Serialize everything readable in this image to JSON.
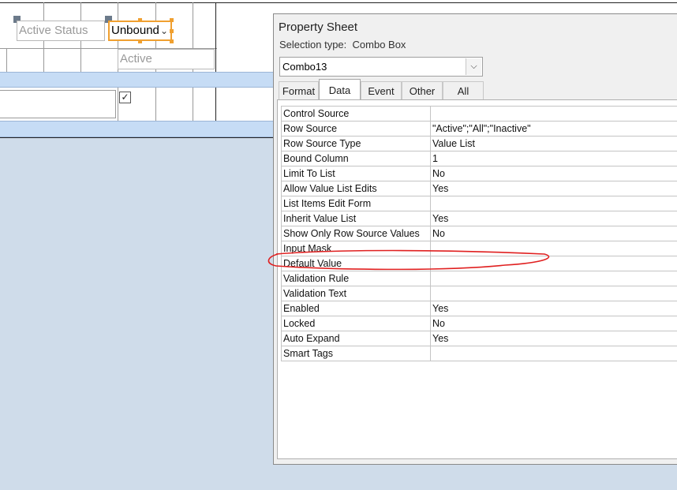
{
  "form": {
    "label_active_status": "Active Status",
    "combo_value": "Unbound",
    "header_active": "Active"
  },
  "property_sheet": {
    "title": "Property Sheet",
    "selection_type_label": "Selection type:",
    "selection_type_value": "Combo Box",
    "object_selector_value": "Combo13",
    "tabs": [
      "Format",
      "Data",
      "Event",
      "Other",
      "All"
    ],
    "active_tab": "Data",
    "properties": [
      {
        "name": "Control Source",
        "value": ""
      },
      {
        "name": "Row Source",
        "value": "\"Active\";\"All\";\"Inactive\""
      },
      {
        "name": "Row Source Type",
        "value": "Value List"
      },
      {
        "name": "Bound Column",
        "value": "1"
      },
      {
        "name": "Limit To List",
        "value": "No"
      },
      {
        "name": "Allow Value List Edits",
        "value": "Yes"
      },
      {
        "name": "List Items Edit Form",
        "value": ""
      },
      {
        "name": "Inherit Value List",
        "value": "Yes"
      },
      {
        "name": "Show Only Row Source Values",
        "value": "No"
      },
      {
        "name": "Input Mask",
        "value": ""
      },
      {
        "name": "Default Value",
        "value": ""
      },
      {
        "name": "Validation Rule",
        "value": ""
      },
      {
        "name": "Validation Text",
        "value": ""
      },
      {
        "name": "Enabled",
        "value": "Yes"
      },
      {
        "name": "Locked",
        "value": "No"
      },
      {
        "name": "Auto Expand",
        "value": "Yes"
      },
      {
        "name": "Smart Tags",
        "value": ""
      }
    ]
  },
  "colors": {
    "selection_handle": "#f0a030",
    "section_bar": "#c6dcf5",
    "annotation": "#e02020"
  }
}
